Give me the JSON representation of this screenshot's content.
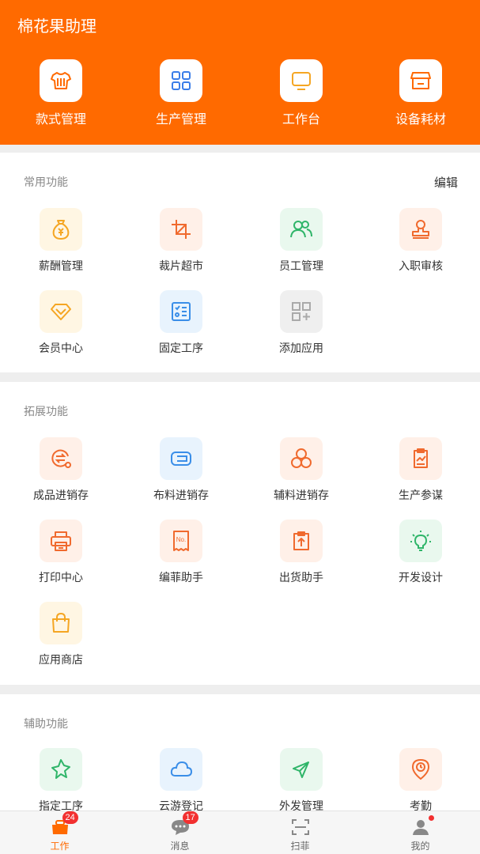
{
  "header": {
    "title": "棉花果助理",
    "items": [
      {
        "label": "款式管理",
        "icon": "shirt-icon"
      },
      {
        "label": "生产管理",
        "icon": "grid-icon"
      },
      {
        "label": "工作台",
        "icon": "monitor-icon"
      },
      {
        "label": "设备耗材",
        "icon": "store-icon"
      }
    ]
  },
  "common": {
    "title": "常用功能",
    "edit_label": "编辑",
    "items": [
      {
        "label": "薪酬管理",
        "icon": "money-bag-icon"
      },
      {
        "label": "裁片超市",
        "icon": "crop-icon"
      },
      {
        "label": "员工管理",
        "icon": "users-icon"
      },
      {
        "label": "入职审核",
        "icon": "stamp-icon"
      },
      {
        "label": "会员中心",
        "icon": "diamond-icon"
      },
      {
        "label": "固定工序",
        "icon": "checklist-icon"
      },
      {
        "label": "添加应用",
        "icon": "add-app-icon"
      }
    ]
  },
  "extended": {
    "title": "拓展功能",
    "items": [
      {
        "label": "成品进销存",
        "icon": "exchange-icon"
      },
      {
        "label": "布料进销存",
        "icon": "fabric-roll-icon"
      },
      {
        "label": "辅料进销存",
        "icon": "buttons-icon"
      },
      {
        "label": "生产参谋",
        "icon": "clipboard-chart-icon"
      },
      {
        "label": "打印中心",
        "icon": "printer-icon"
      },
      {
        "label": "编菲助手",
        "icon": "ticket-icon"
      },
      {
        "label": "出货助手",
        "icon": "shipment-icon"
      },
      {
        "label": "开发设计",
        "icon": "bulb-icon"
      },
      {
        "label": "应用商店",
        "icon": "shopping-bag-icon"
      }
    ]
  },
  "auxiliary": {
    "title": "辅助功能",
    "items": [
      {
        "label": "指定工序",
        "icon": "pin-icon"
      },
      {
        "label": "云游登记",
        "icon": "cloud-icon"
      },
      {
        "label": "外发管理",
        "icon": "send-icon"
      },
      {
        "label": "考勤",
        "icon": "clock-location-icon"
      }
    ]
  },
  "tabbar": {
    "items": [
      {
        "label": "工作",
        "badge": "24",
        "icon": "work-icon"
      },
      {
        "label": "消息",
        "badge": "17",
        "icon": "message-icon"
      },
      {
        "label": "扫菲",
        "icon": "scan-icon"
      },
      {
        "label": "我的",
        "icon": "profile-icon"
      }
    ]
  },
  "colors": {
    "accent": "#ff6a00",
    "badge": "#f23030"
  }
}
